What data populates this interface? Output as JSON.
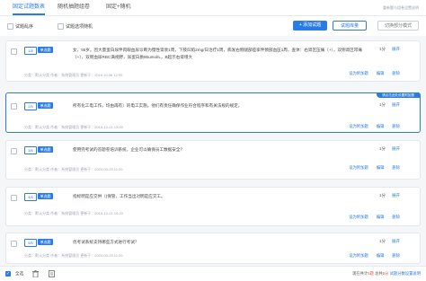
{
  "tabs": [
    {
      "label": "固定试题数表"
    },
    {
      "label": "随机抽题组卷"
    },
    {
      "label": "固定+随机"
    }
  ],
  "top_hint": "重新题与组卷设置说明",
  "controls": {
    "opt1": "试题乱序",
    "opt2": "试题选项随机",
    "add_button": "+ 添加试题",
    "bank_button": "试题库量",
    "batch_button": "切换部分模式"
  },
  "questions": [
    {
      "num": "1/5",
      "type": "单选题",
      "text": "女，55岁。因大量蛋白尿伴肉眼血尿诊断为慢性肾衰1周，下肢凹陷2mg/日治疗1周，病发右侧腿部痉挛伴颈部血压1周，查体：右肾区压痛（+），双侧肾区叩痛（+），双侧血尿RBC满视野，尿蛋白质85umol/L，B超示右肾增大",
      "score": "1分",
      "expand": "展开",
      "meta": "分类：默认分类    作者：系统管理员    更新于：2016.10.06 12:00",
      "actions": [
        "设为附加题",
        "编辑",
        "删除"
      ]
    },
    {
      "num": "2/5",
      "type": "单选题",
      "text": "所有化工电工作，均由再有）的电工实施。他们有责任确保作业符合程序和有关法规的规定。",
      "score": "1分",
      "expand": "展开",
      "ribbon": "请点击此处设置附加题",
      "meta": "分类：默认分类    作者：系统管理员    更新于：2018-10-21 12:00",
      "actions": [
        "设为附加题",
        "编辑",
        "删除"
      ]
    },
    {
      "num": "3/5",
      "type": "单选题",
      "text": "使用完考试的答题卷培训系统，企业可以确保员工数据安全？",
      "score": "1分",
      "expand": "展开",
      "meta": "分类：默认分类    作者：系统管理员    更新于：2020-03-25 11:20",
      "actions": [
        "设为附加题",
        "编辑",
        "删除"
      ]
    },
    {
      "num": "4/5",
      "type": "单选题",
      "text": "指标明是应交供（)保管，工作当出对明是应交工。",
      "score": "1分",
      "expand": "展开",
      "meta": "分类：默认分类    作者：系统管理员    更新于：2018-10-21 10:20",
      "actions": [
        "设为附加题",
        "编辑",
        "删除"
      ]
    },
    {
      "num": "5/5",
      "type": "单选题",
      "text": "优考试系统支持哪些方式进行考试？",
      "score": "1分",
      "expand": "展开",
      "meta": "分类：默认分类    作者：系统管理员    更新于：2020-03-25 11:20",
      "actions": [
        "设为附加题",
        "编辑",
        "删除"
      ]
    }
  ],
  "footer": {
    "select_all": "全选",
    "summary_prefix": "现在共计",
    "count": "5题",
    "summary_mid": " 总共",
    "total": "5分",
    "link": " 试题分数设置说明"
  }
}
